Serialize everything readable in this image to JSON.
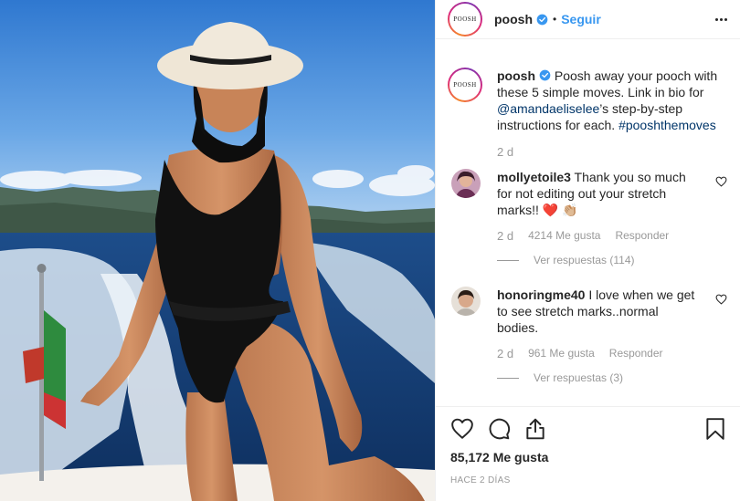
{
  "photo": {
    "alt": ""
  },
  "header": {
    "avatar_text": "POOSH",
    "username": "poosh",
    "verified": true,
    "separator": "•",
    "follow_label": "Seguir",
    "more_icon": "more-horizontal-icon"
  },
  "caption": {
    "avatar_text": "POOSH",
    "username": "poosh",
    "text_1": " Poosh away your pooch with these 5 simple moves. Link in bio for ",
    "mention": "@amandaeliselee",
    "text_2": "’s step-by-step instructions for each. ",
    "hashtag": "#pooshthemoves",
    "age": "2 d"
  },
  "comments": [
    {
      "username": "mollyetoile3",
      "text": " Thank you so much for not editing out your stretch marks!! ❤️ 👏🏼",
      "age": "2 d",
      "likes": "4214 Me gusta",
      "reply": "Responder",
      "view_replies": "Ver respuestas (114)"
    },
    {
      "username": "honoringme40",
      "text": " I love when we get to see stretch marks..normal bodies.",
      "age": "2 d",
      "likes": "961 Me gusta",
      "reply": "Responder",
      "view_replies": "Ver respuestas (3)"
    }
  ],
  "actions": {
    "like_icon": "heart-icon",
    "comment_icon": "comment-icon",
    "share_icon": "share-icon",
    "save_icon": "bookmark-icon"
  },
  "likes_count": "85,172 Me gusta",
  "timestamp": "HACE 2 DÍAS",
  "colors": {
    "link": "#3897f0",
    "mention": "#003569",
    "muted": "#999999",
    "verified": "#3897f0"
  }
}
